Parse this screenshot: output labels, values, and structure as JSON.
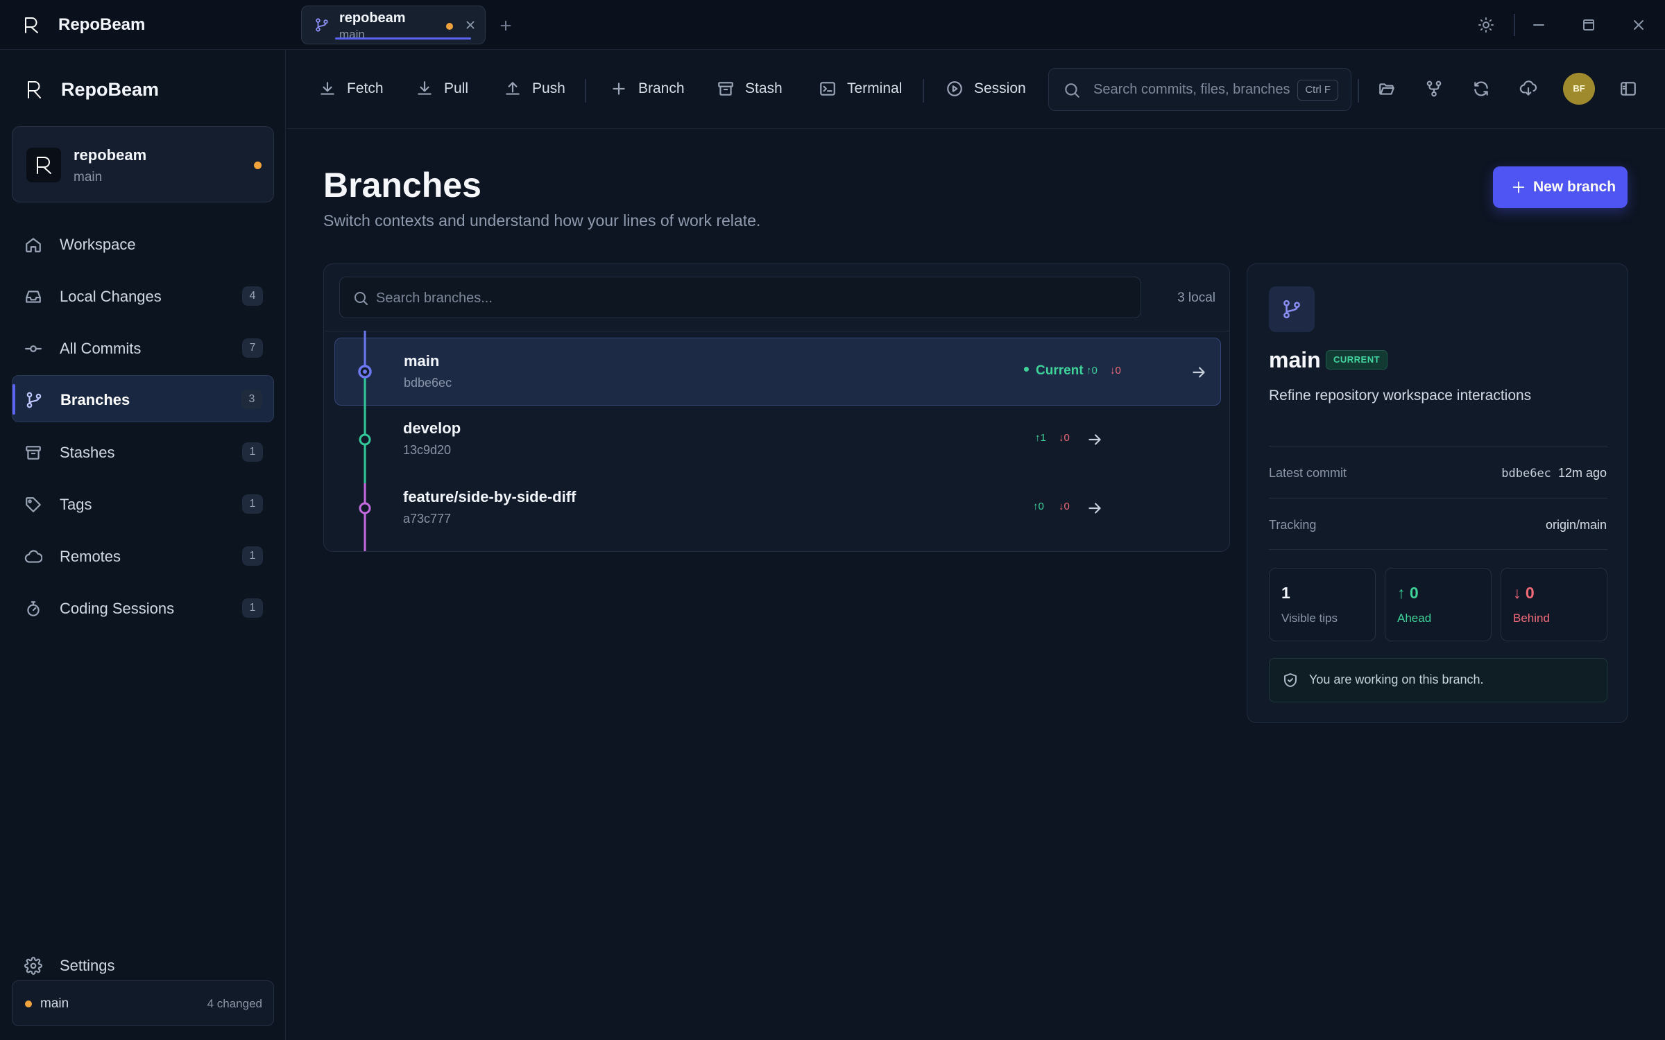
{
  "app": {
    "name": "RepoBeam"
  },
  "window_tab": {
    "title": "repobeam",
    "subtitle": "main"
  },
  "sidebar": {
    "app_name": "RepoBeam",
    "repo": {
      "name": "repobeam",
      "branch": "main"
    },
    "items": [
      {
        "label": "Workspace",
        "badge": null,
        "icon": "home-icon"
      },
      {
        "label": "Local Changes",
        "badge": "4",
        "icon": "inbox-icon"
      },
      {
        "label": "All Commits",
        "badge": "7",
        "icon": "commit-icon"
      },
      {
        "label": "Branches",
        "badge": "3",
        "icon": "branch-icon",
        "active": true
      },
      {
        "label": "Stashes",
        "badge": "1",
        "icon": "archive-icon"
      },
      {
        "label": "Tags",
        "badge": "1",
        "icon": "tag-icon"
      },
      {
        "label": "Remotes",
        "badge": "1",
        "icon": "cloud-icon"
      },
      {
        "label": "Coding Sessions",
        "badge": "1",
        "icon": "timer-icon"
      }
    ],
    "settings_label": "Settings",
    "status": {
      "branch": "main",
      "changed": "4 changed"
    }
  },
  "toolbar": {
    "fetch": "Fetch",
    "pull": "Pull",
    "push": "Push",
    "branch": "Branch",
    "stash": "Stash",
    "terminal": "Terminal",
    "session": "Session",
    "search_placeholder": "Search commits, files, branches",
    "search_shortcut": "Ctrl F",
    "avatar_initials": "BF"
  },
  "page": {
    "title": "Branches",
    "subtitle": "Switch contexts and understand how your lines of work relate.",
    "new_branch_label": "New branch"
  },
  "branch_list": {
    "search_placeholder": "Search branches...",
    "count_label": "3 local",
    "current_label": "Current",
    "branches": [
      {
        "name": "main",
        "hash": "bdbe6ec",
        "ahead": "↑0",
        "behind": "↓0",
        "current": true,
        "color": "#6b78f0"
      },
      {
        "name": "develop",
        "hash": "13c9d20",
        "ahead": "↑1",
        "behind": "↓0",
        "current": false,
        "color": "#34c99a"
      },
      {
        "name": "feature/side-by-side-diff",
        "hash": "a73c777",
        "ahead": "↑0",
        "behind": "↓0",
        "current": false,
        "color": "#c46be0"
      }
    ]
  },
  "detail": {
    "branch_name": "main",
    "badge": "CURRENT",
    "message": "Refine repository workspace interactions",
    "latest_commit_label": "Latest commit",
    "latest_commit_hash": "bdbe6ec",
    "latest_commit_time": "12m ago",
    "tracking_label": "Tracking",
    "tracking_value": "origin/main",
    "stats": {
      "visible_tips": {
        "value": "1",
        "label": "Visible tips"
      },
      "ahead": {
        "value": "↑ 0",
        "label": "Ahead"
      },
      "behind": {
        "value": "↓ 0",
        "label": "Behind"
      }
    },
    "note": "You are working on this branch."
  },
  "colors": {
    "accent": "#4f55f2",
    "success": "#3fd39a",
    "danger": "#f06a78",
    "warning": "#f0a23c",
    "background": "#0d1522"
  }
}
